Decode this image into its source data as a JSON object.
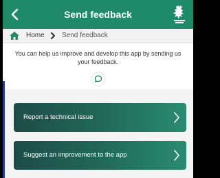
{
  "header": {
    "title": "Send feedback",
    "back_icon": "chevron-left-icon",
    "logo": "club-crest-logo",
    "background_color": "#1f8a68"
  },
  "breadcrumb": {
    "home_icon": "home-icon",
    "home_label": "Home",
    "separator_icon": "chevron-right-icon",
    "current_label": "Send feedback"
  },
  "intro": {
    "text": "You can help us improve and develop this app by sending us your feedback.",
    "icon": "chat-bubble-icon"
  },
  "actions": [
    {
      "label": "Report a technical issue",
      "icon": "chevron-right-icon"
    },
    {
      "label": "Suggest an improvement to the app",
      "icon": "chevron-right-icon"
    }
  ],
  "colors": {
    "accent": "#1f8a68",
    "card_gradient_start": "#1e4b47",
    "card_gradient_end": "#2a8b70"
  }
}
